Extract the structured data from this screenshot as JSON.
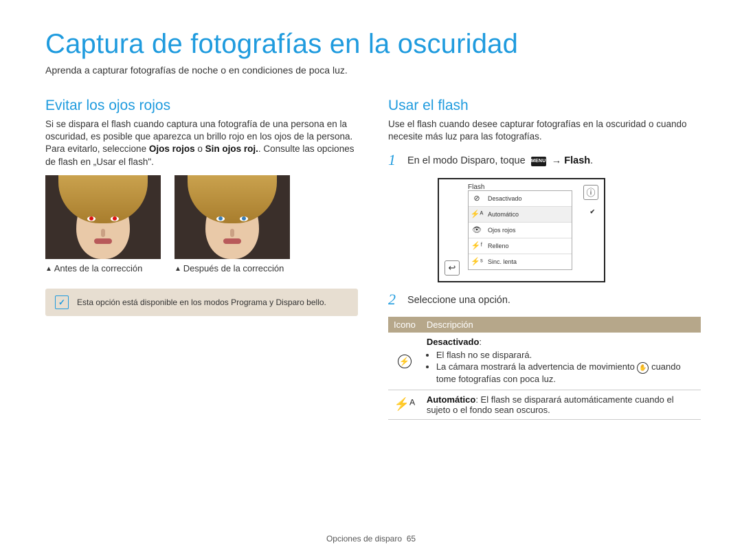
{
  "page": {
    "title": "Captura de fotografías en la oscuridad",
    "intro": "Aprenda a capturar fotografías de noche o en condiciones de poca luz.",
    "footer_section": "Opciones de disparo",
    "footer_page": "65"
  },
  "left": {
    "heading": "Evitar los ojos rojos",
    "para_part1": "Si se dispara el flash cuando captura una fotografía de una persona en la oscuridad, es posible que aparezca un brillo rojo en los ojos de la persona. Para evitarlo, seleccione ",
    "para_bold1": "Ojos rojos",
    "para_part2": " o ",
    "para_bold2": "Sin ojos roj.",
    "para_part3": ". Consulte las opciones de flash en „Usar el flash\".",
    "caption_before": "Antes de la corrección",
    "caption_after": "Después de la corrección",
    "note": "Esta opción está disponible en los modos Programa y Disparo bello."
  },
  "right": {
    "heading": "Usar el flash",
    "para": "Use el flash cuando desee capturar fotografías en la oscuridad o cuando necesite más luz para las fotografías.",
    "step1_a": "En el modo Disparo, toque ",
    "step1_menu": "MENU",
    "step1_b": " → ",
    "step1_bold": "Flash",
    "step1_c": ".",
    "ui": {
      "title": "Flash",
      "options": [
        {
          "icon": "⊘",
          "label": "Desactivado"
        },
        {
          "icon": "⚡ᴬ",
          "label": "Automático",
          "selected": true
        },
        {
          "icon": "👁",
          "label": "Ojos rojos"
        },
        {
          "icon": "⚡ᶠ",
          "label": "Relleno"
        },
        {
          "icon": "⚡ˢ",
          "label": "Sinc. lenta"
        }
      ],
      "info": "ⓘ",
      "back": "↩"
    },
    "step2": "Seleccione una opción.",
    "table": {
      "col1": "Icono",
      "col2": "Descripción",
      "rows": [
        {
          "icon": "⊘",
          "title": "Desactivado",
          "title_suffix": ":",
          "bullets": [
            "El flash no se disparará.",
            "La cámara mostrará la advertencia de movimiento {hand} cuando tome fotografías con poca luz."
          ]
        },
        {
          "icon": "⚡ᴬ",
          "title": "Automático",
          "line": ": El flash se disparará automáticamente cuando el sujeto o el fondo sean oscuros."
        }
      ]
    }
  }
}
